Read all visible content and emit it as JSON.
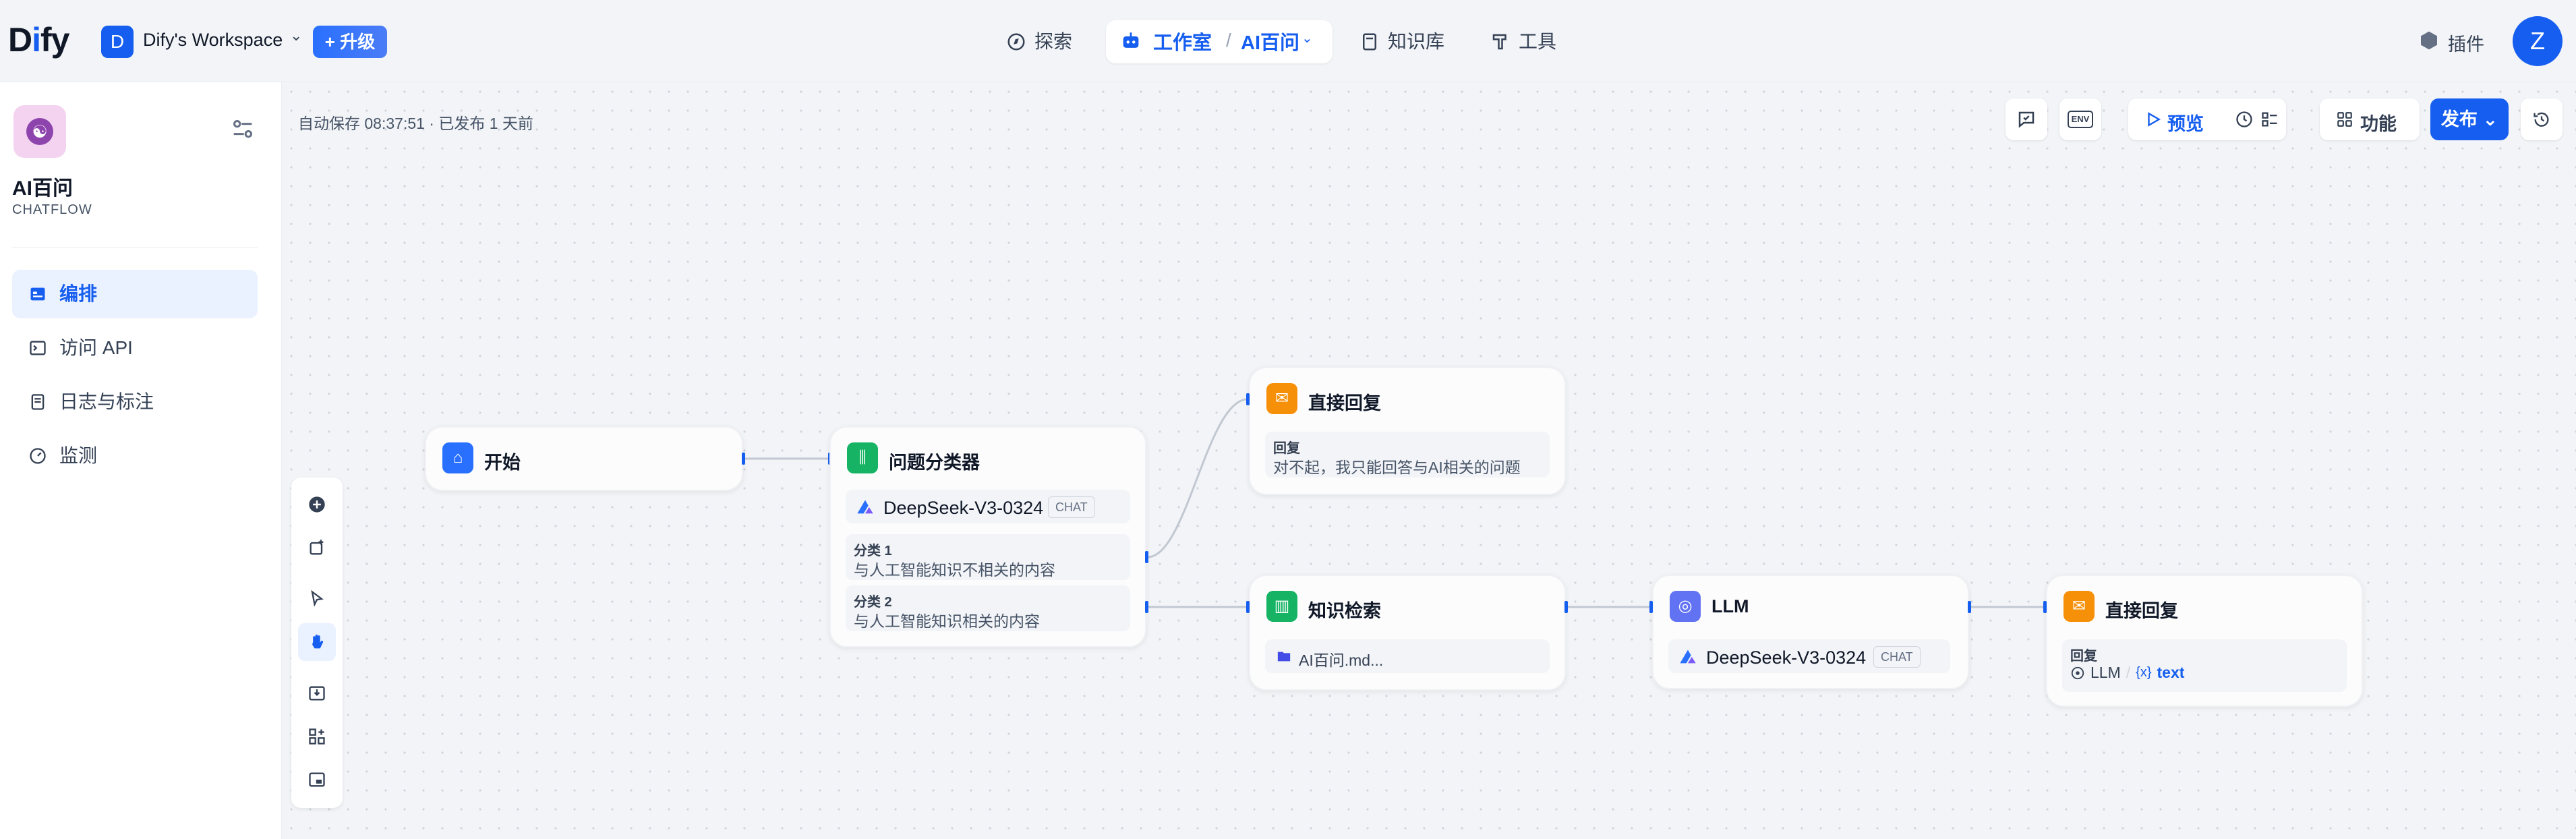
{
  "brand": {
    "logo_text": "Dify",
    "accent": "#155eef"
  },
  "workspace": {
    "initial": "D",
    "name": "Dify's Workspace",
    "upgrade_label": "+ 升级"
  },
  "nav": {
    "explore": "探索",
    "studio": "工作室",
    "current_app": "AI百问",
    "knowledge": "知识库",
    "tools": "工具",
    "plugins": "插件",
    "user_initial": "Z"
  },
  "sidebar": {
    "app_name": "AI百问",
    "app_type": "CHATFLOW",
    "items": [
      {
        "label": "编排",
        "icon": "layout-icon",
        "active": true
      },
      {
        "label": "访问 API",
        "icon": "terminal-icon",
        "active": false
      },
      {
        "label": "日志与标注",
        "icon": "file-list-icon",
        "active": false
      },
      {
        "label": "监测",
        "icon": "monitor-gauge-icon",
        "active": false
      }
    ]
  },
  "canvas": {
    "autosave": "自动保存 08:37:51 · 已发布 1 天前",
    "toolbar": {
      "env": "ENV",
      "preview": "预览",
      "features": "功能",
      "publish": "发布"
    }
  },
  "nodes": {
    "start": {
      "title": "开始",
      "icon": "home-icon"
    },
    "classifier": {
      "title": "问题分类器",
      "model": "DeepSeek-V3-0324",
      "model_badge": "CHAT",
      "classes": [
        {
          "label": "分类 1",
          "text": "与人工智能知识不相关的内容"
        },
        {
          "label": "分类 2",
          "text": "与人工智能知识相关的内容"
        }
      ]
    },
    "answer1": {
      "title": "直接回复",
      "field_label": "回复",
      "text": "对不起，我只能回答与AI相关的问题"
    },
    "knowledge": {
      "title": "知识检索",
      "dataset": "AI百问.md..."
    },
    "llm": {
      "title": "LLM",
      "model": "DeepSeek-V3-0324",
      "model_badge": "CHAT"
    },
    "answer2": {
      "title": "直接回复",
      "field_label": "回复",
      "var_node": "LLM",
      "var_name": "text",
      "var_prefix": "{x}"
    }
  }
}
